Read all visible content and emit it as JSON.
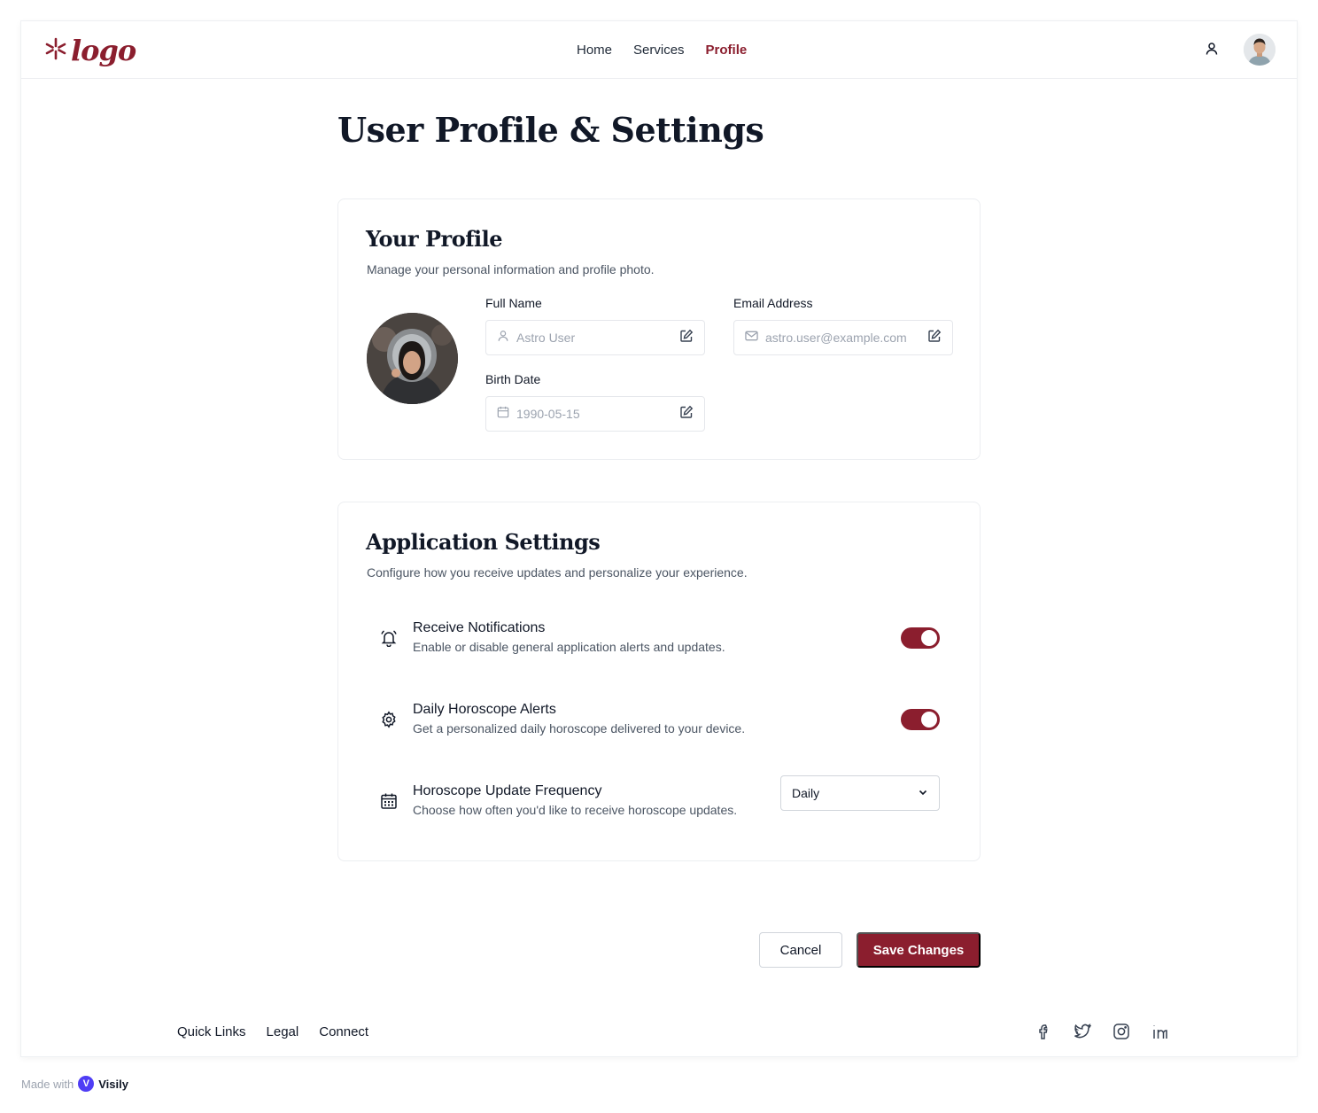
{
  "brand": {
    "logo_text": "logo",
    "accent": "#8b1e2e"
  },
  "nav": {
    "items": [
      {
        "label": "Home",
        "active": false
      },
      {
        "label": "Services",
        "active": false
      },
      {
        "label": "Profile",
        "active": true
      }
    ]
  },
  "page": {
    "title": "User Profile & Settings"
  },
  "profile_card": {
    "title": "Your Profile",
    "description": "Manage your personal information and profile photo.",
    "full_name": {
      "label": "Full Name",
      "value": "Astro User"
    },
    "email": {
      "label": "Email Address",
      "value": "astro.user@example.com"
    },
    "birth_date": {
      "label": "Birth Date",
      "value": "1990-05-15"
    }
  },
  "settings_card": {
    "title": "Application Settings",
    "description": "Configure how you receive updates and personalize your experience.",
    "notifications": {
      "title": "Receive Notifications",
      "description": "Enable or disable general application alerts and updates.",
      "enabled": true,
      "icon": "bell-icon"
    },
    "horoscope_alerts": {
      "title": "Daily Horoscope Alerts",
      "description": "Get a personalized daily horoscope delivered to your device.",
      "enabled": true,
      "icon": "gear-icon"
    },
    "frequency": {
      "title": "Horoscope Update Frequency",
      "description": "Choose how often you'd like to receive horoscope updates.",
      "selected": "Daily",
      "icon": "calendar-icon"
    }
  },
  "actions": {
    "cancel": "Cancel",
    "save": "Save Changes"
  },
  "footer": {
    "links": [
      "Quick Links",
      "Legal",
      "Connect"
    ],
    "social_icons": [
      "facebook-icon",
      "twitter-icon",
      "instagram-icon",
      "linkedin-icon"
    ]
  },
  "made_with": {
    "prefix": "Made with",
    "brand": "Visily"
  }
}
